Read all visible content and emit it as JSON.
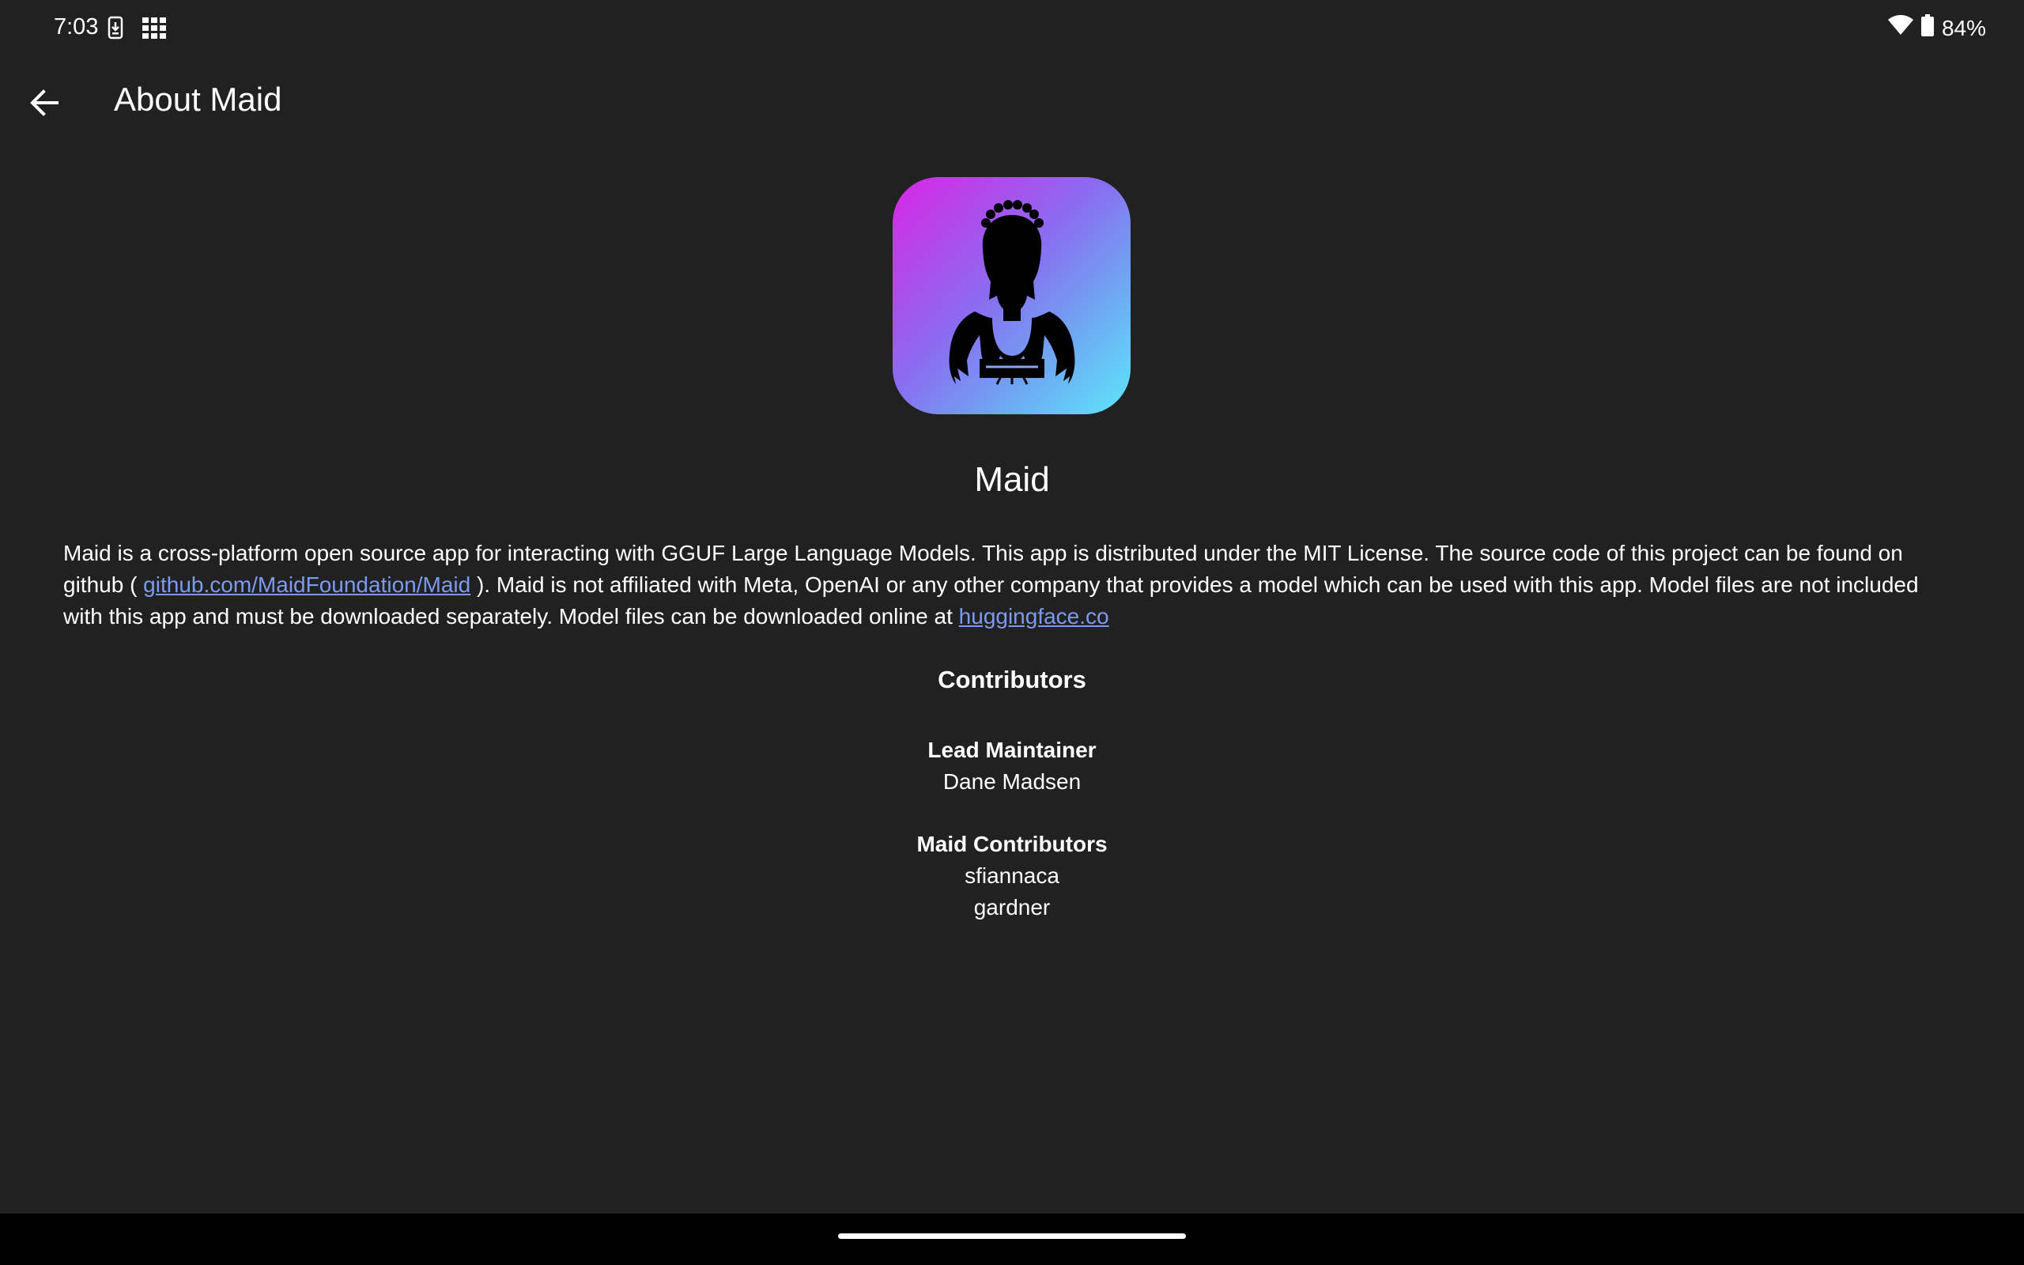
{
  "status_bar": {
    "time": "7:03",
    "battery": "84%",
    "icons": [
      "screenshot-icon",
      "app-grid-icon",
      "wifi-icon",
      "battery-icon"
    ]
  },
  "app_bar": {
    "title": "About Maid",
    "back_icon": "arrow-back-icon"
  },
  "app": {
    "name": "Maid",
    "logo": "maid-logo"
  },
  "description": {
    "part1": "Maid is a cross-platform open source app for interacting with GGUF Large Language Models. This app is distributed under the MIT License. The source code of this project can be found on github ( ",
    "link1": "github.com/MaidFoundation/Maid",
    "part2": " ). Maid is not affiliated with Meta, OpenAI or any other company that provides a model which can be used with this app. Model files are not included with this app and must be downloaded separately. Model files can be downloaded online at ",
    "link2": "huggingface.co"
  },
  "contributors": {
    "title": "Contributors",
    "lead_title": "Lead Maintainer",
    "lead_name": "Dane Madsen",
    "others_title": "Maid Contributors",
    "others": [
      "sfiannaca",
      "gardner"
    ]
  },
  "colors": {
    "background": "#212121",
    "link": "#7c9bf0",
    "logo_gradient_start": "#d926e6",
    "logo_gradient_end": "#5ee6fb"
  }
}
